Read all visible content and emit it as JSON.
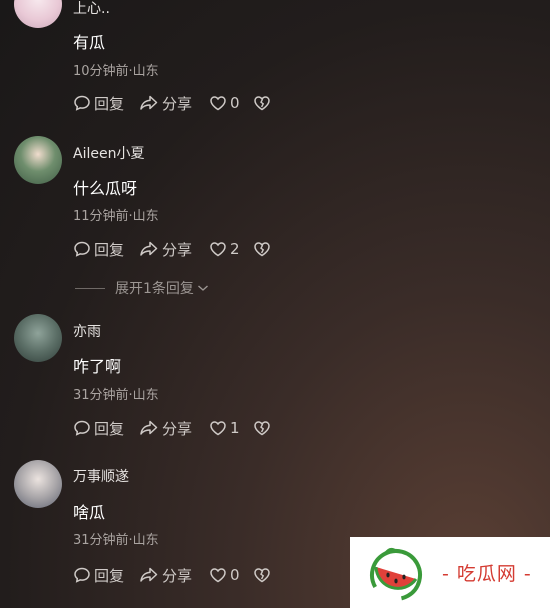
{
  "comments": [
    {
      "username": "上心..",
      "text": "有瓜",
      "meta": "10分钟前·山东",
      "reply_label": "回复",
      "share_label": "分享",
      "likes": "0"
    },
    {
      "username": "Aileen小夏",
      "text": "什么瓜呀",
      "meta": "11分钟前·山东",
      "reply_label": "回复",
      "share_label": "分享",
      "likes": "2"
    },
    {
      "username": "亦雨",
      "text": "咋了啊",
      "meta": "31分钟前·山东",
      "reply_label": "回复",
      "share_label": "分享",
      "likes": "1"
    },
    {
      "username": "万事顺遂",
      "text": "啥瓜",
      "meta": "31分钟前·山东",
      "reply_label": "回复",
      "share_label": "分享",
      "likes": "0"
    }
  ],
  "expand_replies_label": "展开1条回复",
  "watermark": {
    "text": "- 吃瓜网 -",
    "color": "#d43b32"
  }
}
